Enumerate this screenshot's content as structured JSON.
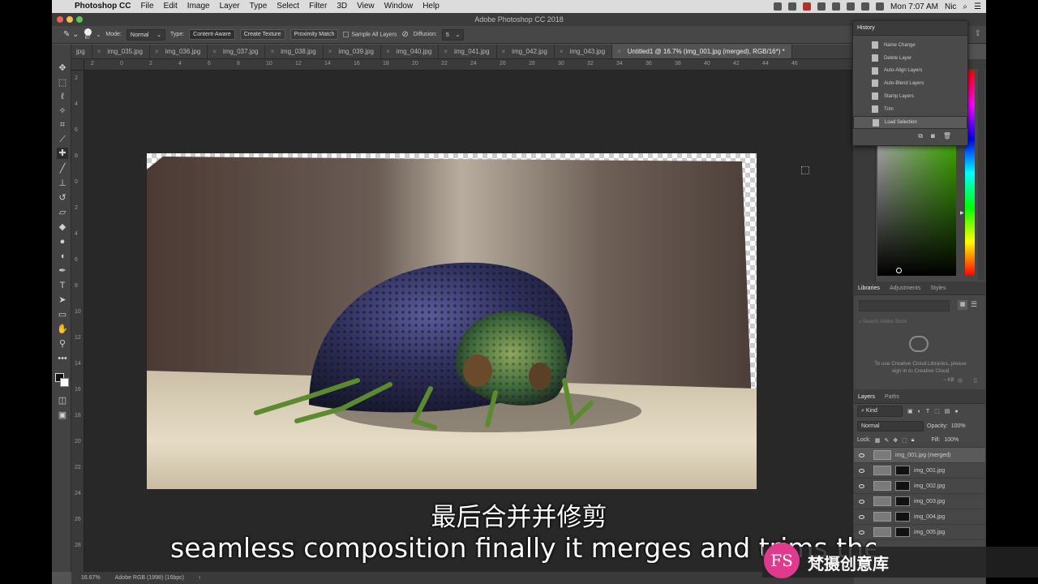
{
  "menubar": {
    "app_name": "Photoshop CC",
    "items": [
      "File",
      "Edit",
      "Image",
      "Layer",
      "Type",
      "Select",
      "Filter",
      "3D",
      "View",
      "Window",
      "Help"
    ],
    "clock": "Mon 7:07 AM",
    "user": "Nic"
  },
  "window": {
    "title": "Adobe Photoshop CC 2018"
  },
  "options": {
    "brush_size": "67",
    "mode_label": "Mode:",
    "mode_value": "Normal",
    "type_label": "Type:",
    "type_buttons": [
      "Content-Aware",
      "Create Texture",
      "Proximity Match"
    ],
    "sample_all_layers": "Sample All Layers",
    "diffusion_label": "Diffusion:",
    "diffusion_value": "5"
  },
  "tabs": [
    "jpg",
    "img_035.jpg",
    "img_036.jpg",
    "img_037.jpg",
    "img_038.jpg",
    "img_039.jpg",
    "img_040.jpg",
    "img_041.jpg",
    "img_042.jpg",
    "img_043.jpg",
    "Untitled1 @ 16.7% (img_001.jpg (merged), RGB/16*) *"
  ],
  "active_tab_index": 10,
  "ruler_h": [
    "2",
    "0",
    "2",
    "4",
    "6",
    "8",
    "10",
    "12",
    "14",
    "16",
    "18",
    "20",
    "22",
    "24",
    "26",
    "28",
    "30",
    "32",
    "34",
    "36",
    "38",
    "40",
    "42",
    "44",
    "46"
  ],
  "ruler_v": [
    "2",
    "4",
    "6",
    "8",
    "0",
    "2",
    "4",
    "6",
    "8",
    "10",
    "12",
    "14",
    "16",
    "18",
    "20",
    "22",
    "24",
    "26",
    "28"
  ],
  "status": {
    "zoom": "16.67%",
    "profile": "Adobe RGB (1998) (16bpc)"
  },
  "history": {
    "title": "History",
    "items": [
      "Name Change",
      "Delete Layer",
      "Auto-Align Layers",
      "Auto-Blend Layers",
      "Stamp Layers",
      "Trim",
      "Load Selection"
    ],
    "selected_index": 6
  },
  "libraries": {
    "tabs": [
      "Libraries",
      "Adjustments",
      "Styles"
    ],
    "search_placeholder": "Search Adobe Stock",
    "message": "To use Creative Cloud Libraries, please sign in to Creative Cloud",
    "size": "-- KB"
  },
  "layers": {
    "tabs": [
      "Layers",
      "Paths"
    ],
    "kind": "Kind",
    "blend_mode": "Normal",
    "opacity_label": "Opacity:",
    "opacity": "100%",
    "lock_label": "Lock:",
    "fill_label": "Fill:",
    "fill": "100%",
    "items": [
      "img_001.jpg (merged)",
      "img_001.jpg",
      "img_002.jpg",
      "img_003.jpg",
      "img_004.jpg",
      "img_005.jpg"
    ]
  },
  "subtitles": {
    "cn": "最后合并并修剪",
    "en": "seamless composition finally it merges and trims the"
  },
  "watermark": {
    "logo": "FS",
    "text": "梵摄创意库"
  },
  "colors": {
    "accent": "#e03a8e",
    "panel_bg": "#474747",
    "canvas_bg": "#282828"
  }
}
